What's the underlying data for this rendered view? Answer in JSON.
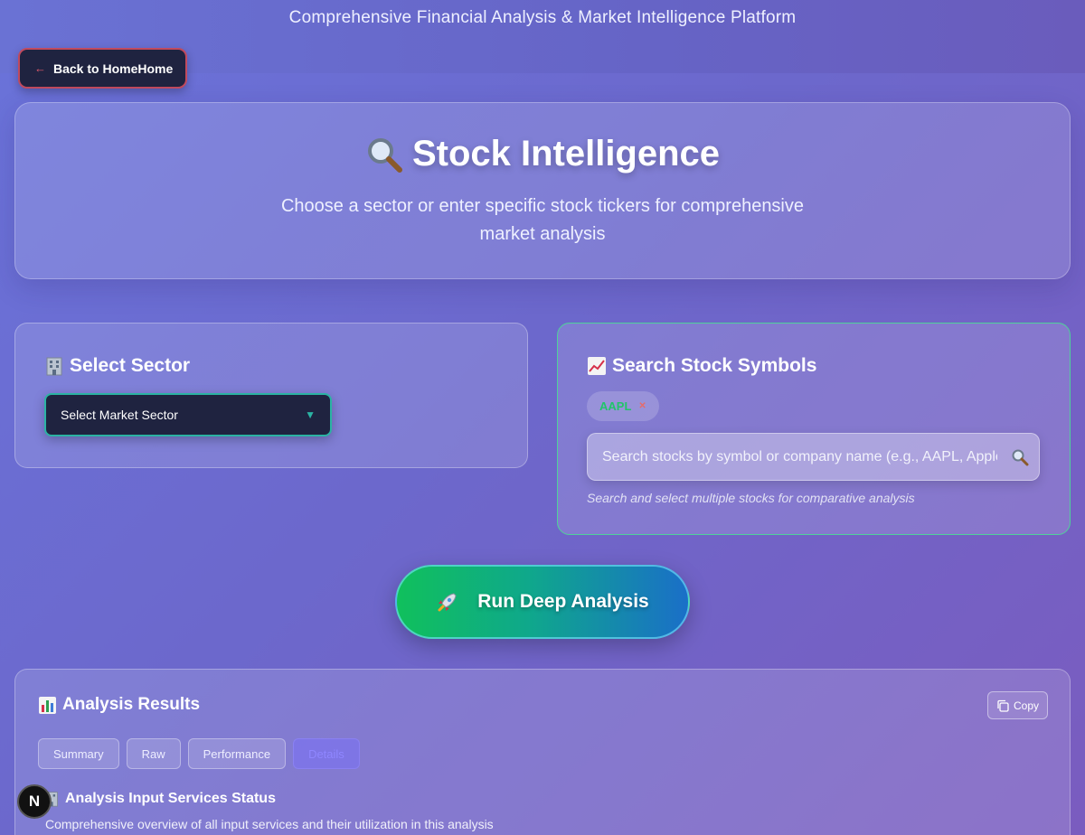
{
  "header": {
    "tagline": "Comprehensive Financial Analysis & Market Intelligence Platform",
    "back_label": "Back to HomeHome"
  },
  "hero": {
    "title": "Stock Intelligence",
    "subtitle": "Choose a sector or enter specific stock tickers for comprehensive market analysis"
  },
  "sector": {
    "title": "Select Sector",
    "select_value": "Select Market Sector"
  },
  "search": {
    "title": "Search Stock Symbols",
    "chip": "AAPL",
    "placeholder": "Search stocks by symbol or company name (e.g., AAPL, Apple)",
    "hint": "Search and select multiple stocks for comparative analysis"
  },
  "run_label": "Run Deep Analysis",
  "results": {
    "title": "Analysis Results",
    "copy_label": "Copy",
    "tabs": [
      "Summary",
      "Raw",
      "Performance",
      "Details"
    ],
    "active_tab": "Details",
    "services_title": "Analysis Input Services Status",
    "services_desc": "Comprehensive overview of all input services and their utilization in this analysis"
  },
  "dev_badge": "N",
  "colors": {
    "accent_green": "#10c05c",
    "accent_blue": "#1a6fc8",
    "danger": "#c04a5e",
    "dark": "#1f2340"
  }
}
